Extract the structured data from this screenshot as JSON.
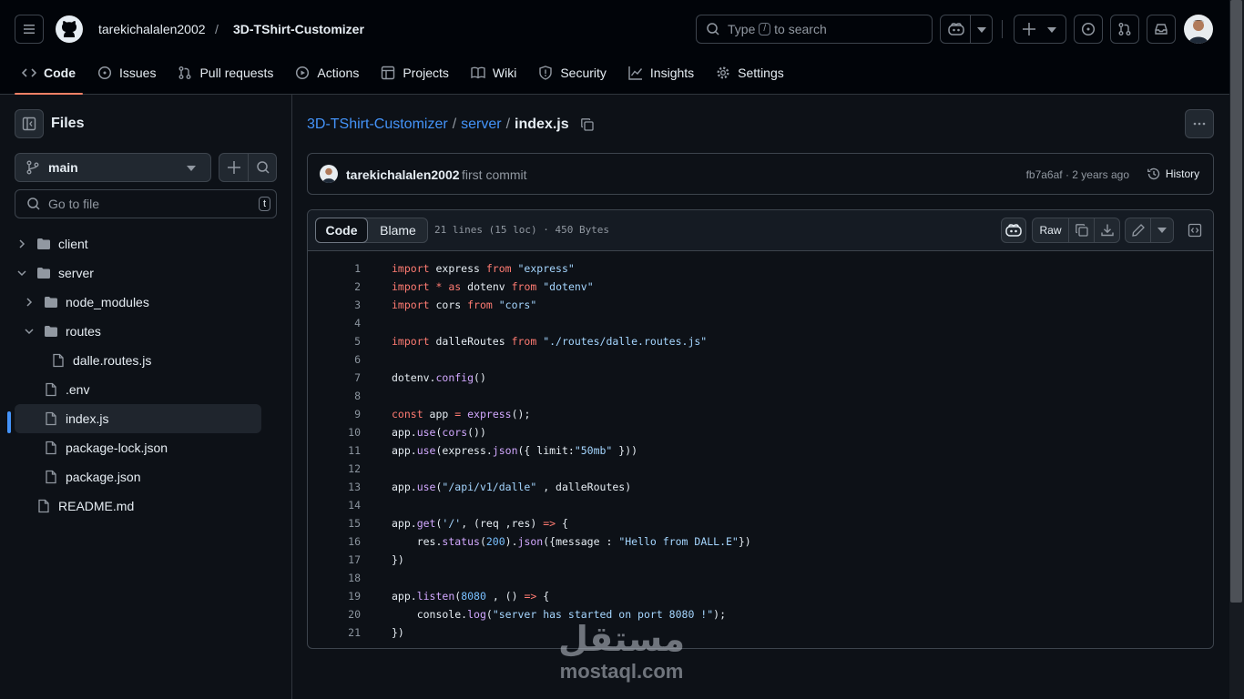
{
  "header": {
    "owner": "tarekichalalen2002",
    "separator": "/",
    "repo": "3D-TShirt-Customizer",
    "search_pre": "Type",
    "search_key": "/",
    "search_post": "to search"
  },
  "nav": {
    "tabs": [
      {
        "label": "Code",
        "icon": "code-icon"
      },
      {
        "label": "Issues",
        "icon": "issue-icon"
      },
      {
        "label": "Pull requests",
        "icon": "pull-request-icon"
      },
      {
        "label": "Actions",
        "icon": "play-icon"
      },
      {
        "label": "Projects",
        "icon": "table-icon"
      },
      {
        "label": "Wiki",
        "icon": "book-icon"
      },
      {
        "label": "Security",
        "icon": "shield-icon"
      },
      {
        "label": "Insights",
        "icon": "graph-icon"
      },
      {
        "label": "Settings",
        "icon": "gear-icon"
      }
    ]
  },
  "sidebar": {
    "title": "Files",
    "branch": "main",
    "goto_placeholder": "Go to file",
    "goto_key": "t",
    "tree": [
      {
        "label": "client",
        "type": "folder",
        "expanded": false
      },
      {
        "label": "server",
        "type": "folder",
        "expanded": true
      },
      {
        "label": "node_modules",
        "type": "folder",
        "expanded": false
      },
      {
        "label": "routes",
        "type": "folder",
        "expanded": true
      },
      {
        "label": "dalle.routes.js",
        "type": "file"
      },
      {
        "label": ".env",
        "type": "file"
      },
      {
        "label": "index.js",
        "type": "file",
        "selected": true
      },
      {
        "label": "package-lock.json",
        "type": "file"
      },
      {
        "label": "package.json",
        "type": "file"
      },
      {
        "label": "README.md",
        "type": "file"
      }
    ]
  },
  "breadcrumb": {
    "repo": "3D-TShirt-Customizer",
    "sep1": "/",
    "folder": "server",
    "sep2": "/",
    "file": "index.js"
  },
  "commit": {
    "author": "tarekichalalen2002",
    "message": "first commit",
    "sha_time": "fb7a6af · 2 years ago",
    "history_label": "History"
  },
  "file_toolbar": {
    "code_tab": "Code",
    "blame_tab": "Blame",
    "info": "21 lines (15 loc) · 450 Bytes",
    "raw_label": "Raw"
  },
  "code": [
    "import express from \"express\"",
    "import * as dotenv from \"dotenv\"",
    "import cors from \"cors\"",
    "",
    "import dalleRoutes from \"./routes/dalle.routes.js\"",
    "",
    "dotenv.config()",
    "",
    "const app = express();",
    "app.use(cors())",
    "app.use(express.json({ limit:\"50mb\" }))",
    "",
    "app.use(\"/api/v1/dalle\" , dalleRoutes)",
    "",
    "app.get('/', (req ,res) => {",
    "    res.status(200).json({message : \"Hello from DALL.E\"})",
    "})",
    "",
    "app.listen(8080 , () => {",
    "    console.log(\"server has started on port 8080 !\");",
    "})"
  ],
  "watermark": {
    "arabic": "مستقل",
    "latin": "mostaql.com"
  },
  "colors": {
    "accent_link": "#4493f8",
    "active_tab_underline": "#f78166",
    "selected_marker": "#4493f8"
  }
}
